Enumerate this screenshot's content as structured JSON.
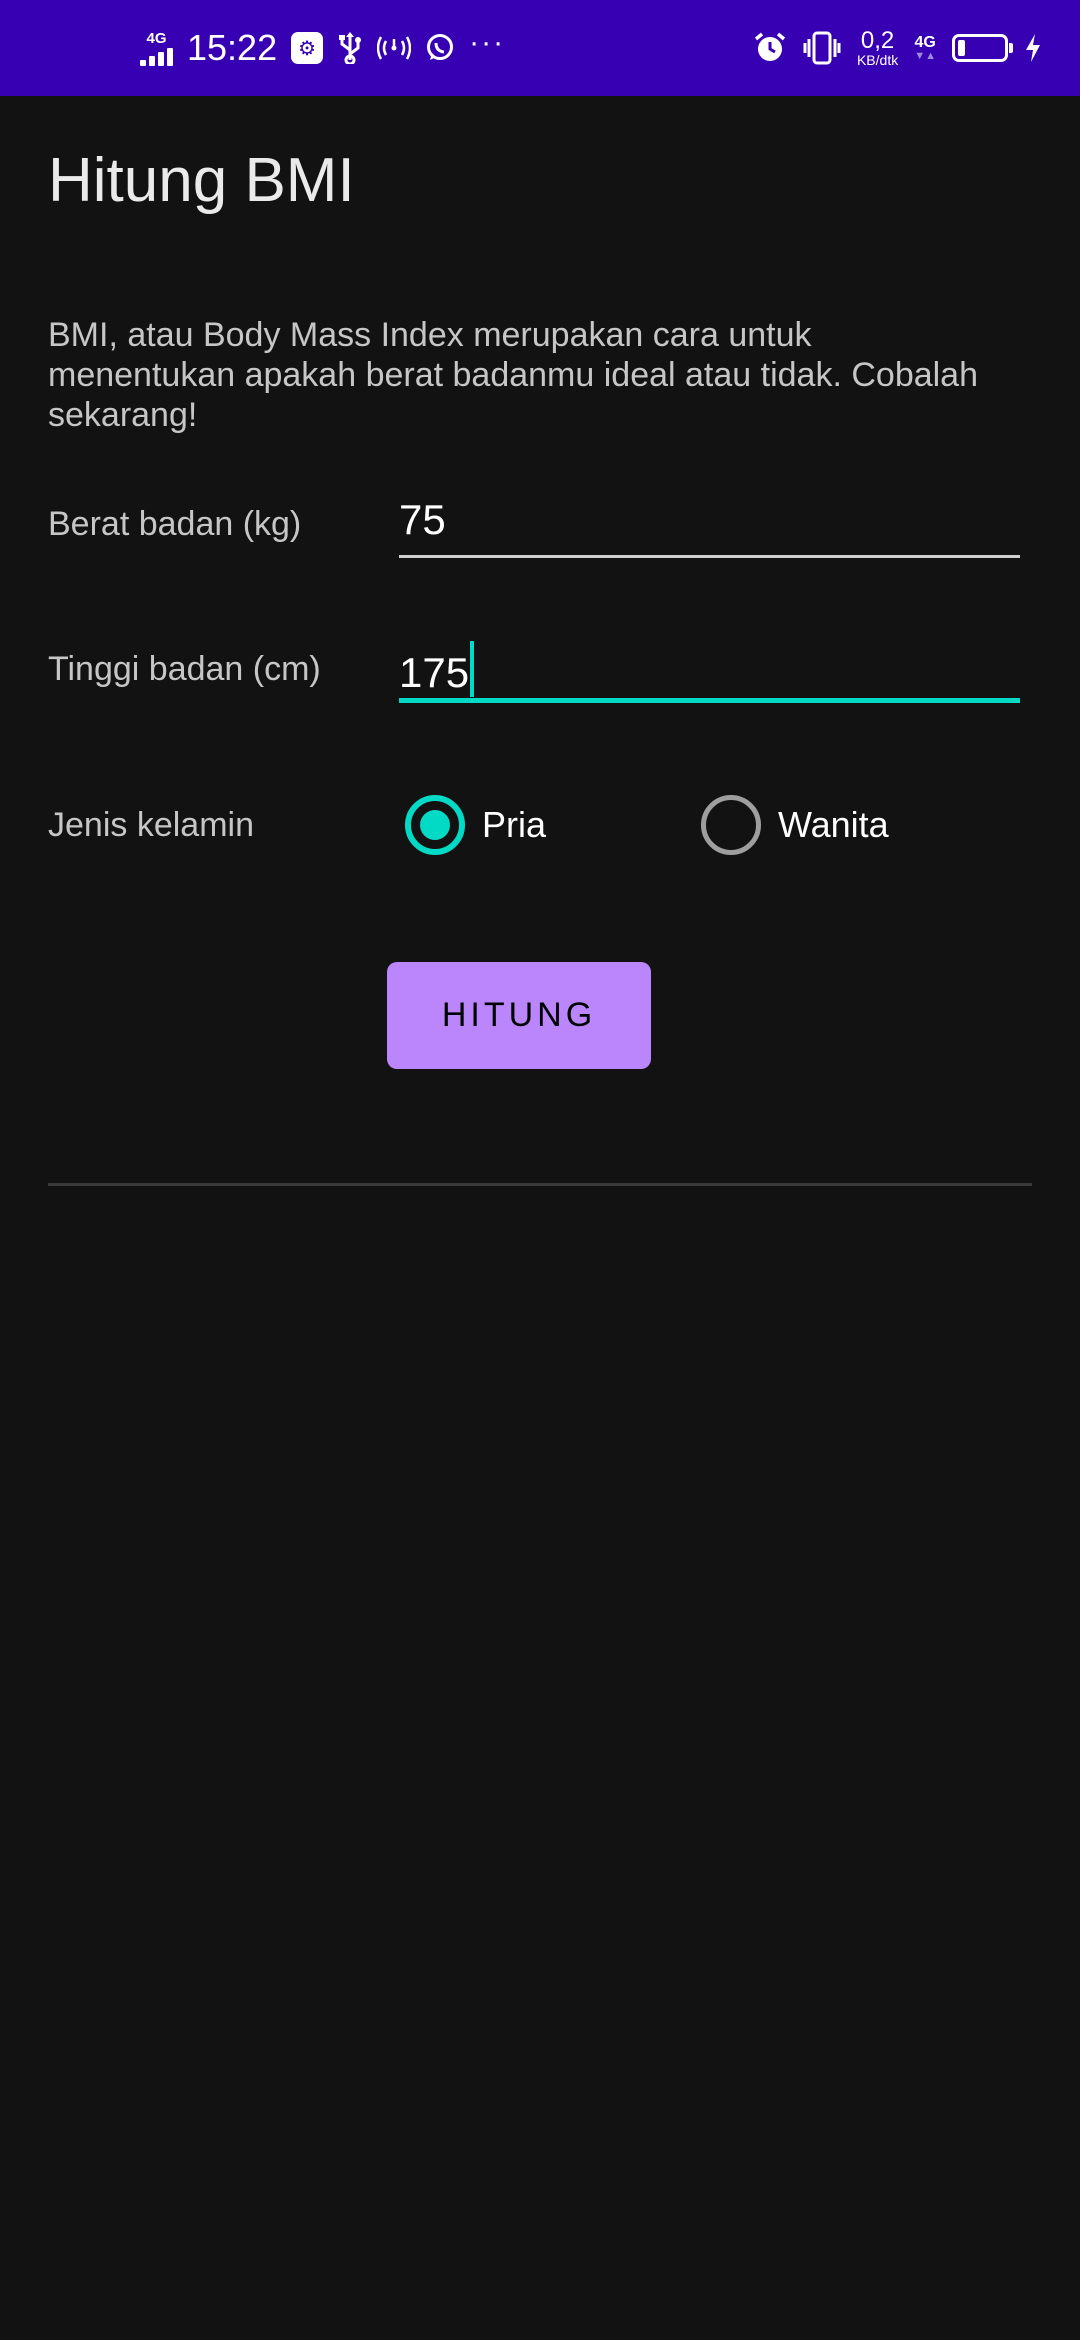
{
  "status_bar": {
    "network_left": "4G",
    "time": "15:22",
    "speed_value": "0,2",
    "speed_unit": "KB/dtk",
    "network_right": "4G",
    "battery_level": 0.15,
    "icons": [
      "signal-icon",
      "usb-debug-icon",
      "usb-icon",
      "hotspot-icon",
      "whatsapp-icon",
      "more-dots-icon",
      "alarm-icon",
      "vibrate-icon",
      "battery-icon",
      "charging-icon"
    ]
  },
  "app": {
    "title": "Hitung BMI",
    "description": "BMI, atau Body Mass Index merupakan cara untuk menentukan apakah berat badanmu ideal atau tidak. Cobalah sekarang!"
  },
  "form": {
    "weight": {
      "label": "Berat badan (kg)",
      "value": "75"
    },
    "height": {
      "label": "Tinggi badan (cm)",
      "value": "175"
    },
    "gender": {
      "label": "Jenis kelamin",
      "options": [
        "Pria",
        "Wanita"
      ],
      "selected": "Pria"
    },
    "submit_label": "HITUNG"
  },
  "colors": {
    "status_bar": "#3700b3",
    "background": "#121212",
    "accent": "#03dac5",
    "button": "#bb86fc"
  }
}
